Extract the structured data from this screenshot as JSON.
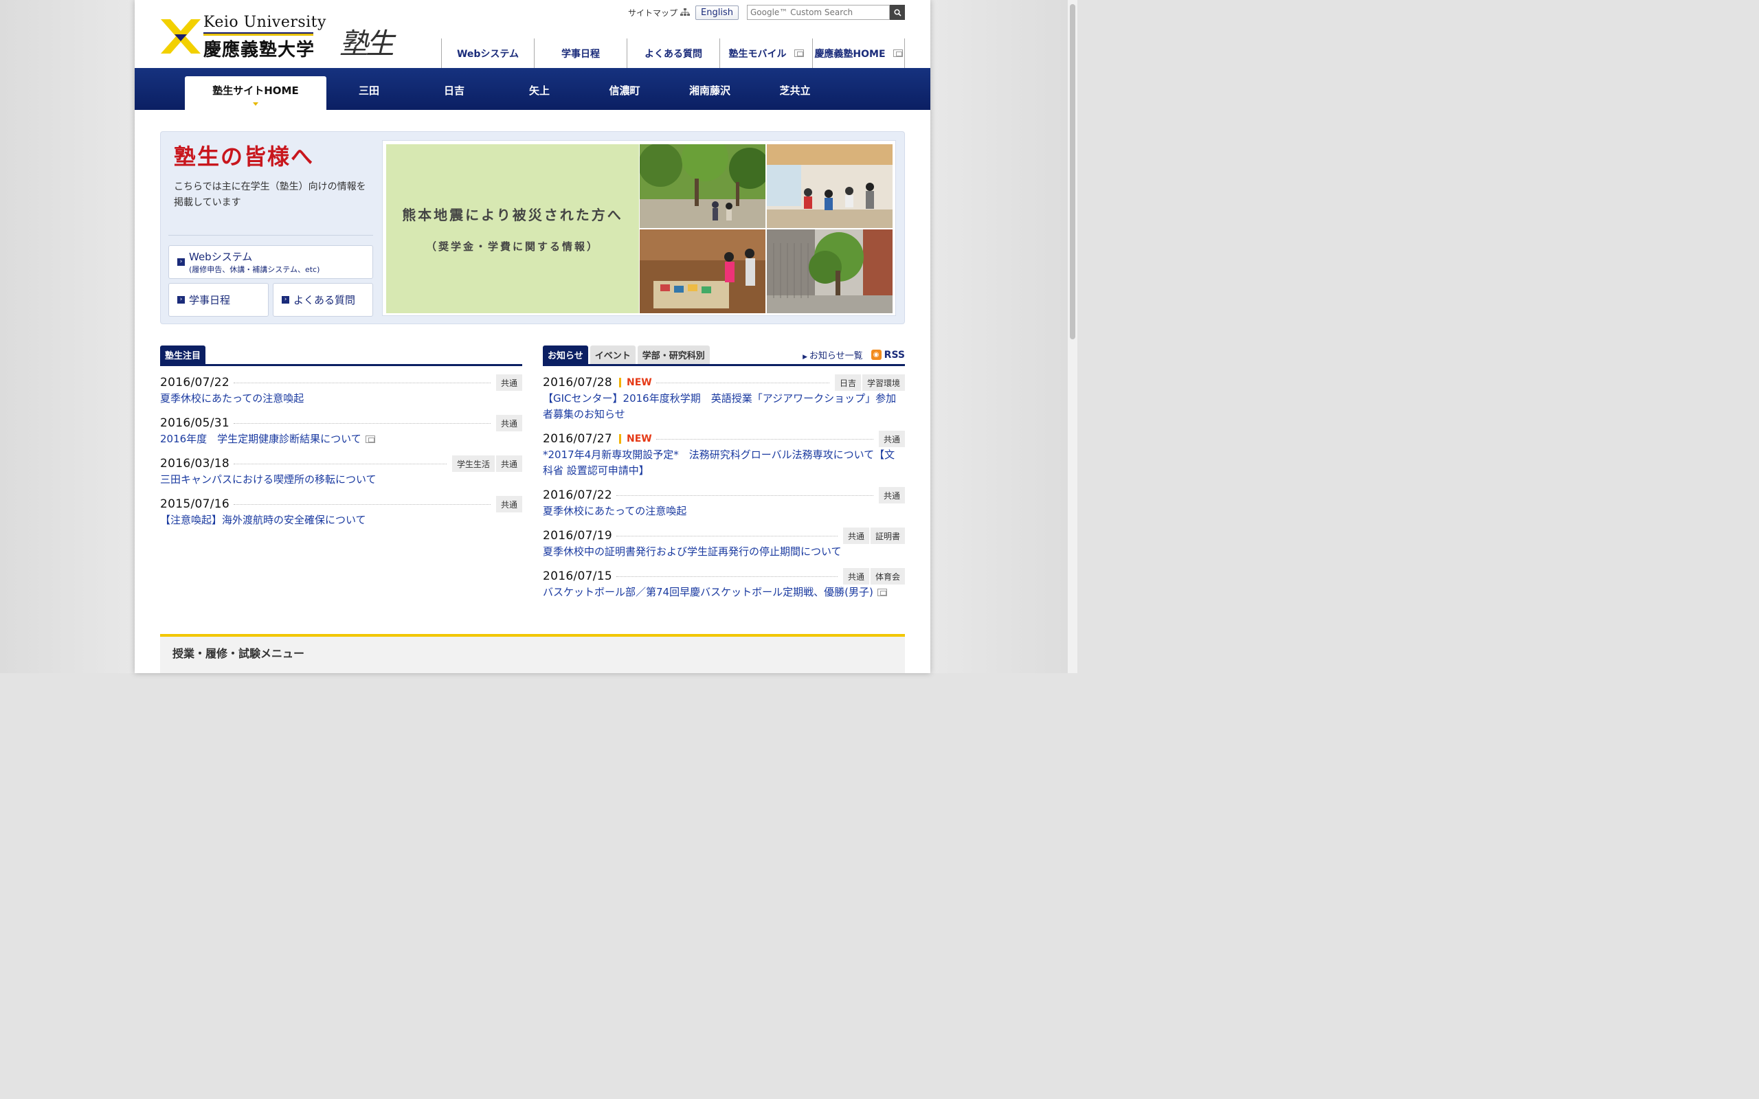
{
  "header": {
    "logo_en": "Keio University",
    "logo_ja": "慶應義塾大学",
    "site_logo": "塾生",
    "sitemap_label": "サイトマップ",
    "english_label": "English",
    "search_placeholder": "Google™ Custom Search",
    "topnav": [
      {
        "label": "Webシステム",
        "external": false
      },
      {
        "label": "学事日程",
        "external": false
      },
      {
        "label": "よくある質問",
        "external": false
      },
      {
        "label": "塾生モバイル",
        "external": true
      },
      {
        "label": "慶應義塾HOME",
        "external": true
      }
    ]
  },
  "campus_nav": {
    "tabs": [
      "塾生サイトHOME",
      "三田",
      "日吉",
      "矢上",
      "信濃町",
      "湘南藤沢",
      "芝共立"
    ],
    "active": 0
  },
  "hero": {
    "title": "塾生の皆様へ",
    "description": "こちらでは主に在学生（塾生）向けの情報を掲載しています",
    "webs_label": "Webシステム",
    "webs_sub": "(履修申告、休講・補講システム、etc)",
    "schedule_label": "学事日程",
    "faq_label": "よくある質問",
    "banner_main": "熊本地震により被災された方へ",
    "banner_sub": "（奨学金・学費に関する情報）"
  },
  "featured": {
    "tab_label": "塾生注目",
    "items": [
      {
        "date": "2016/07/22",
        "tags": [
          "共通"
        ],
        "title": "夏季休校にあたっての注意喚起",
        "external": false
      },
      {
        "date": "2016/05/31",
        "tags": [
          "共通"
        ],
        "title": "2016年度　学生定期健康診断結果について",
        "external": true
      },
      {
        "date": "2016/03/18",
        "tags": [
          "学生生活",
          "共通"
        ],
        "title": "三田キャンパスにおける喫煙所の移転について",
        "external": false
      },
      {
        "date": "2015/07/16",
        "tags": [
          "共通"
        ],
        "title": "【注意喚起】海外渡航時の安全確保について",
        "external": false
      }
    ]
  },
  "news": {
    "tabs": [
      "お知らせ",
      "イベント",
      "学部・研究科別"
    ],
    "list_link": "お知らせ一覧",
    "rss_label": "RSS",
    "items": [
      {
        "date": "2016/07/28",
        "new": "NEW",
        "tags": [
          "日吉",
          "学習環境"
        ],
        "title": "【GICセンター】2016年度秋学期　英語授業「アジアワークショップ」参加者募集のお知らせ",
        "external": false
      },
      {
        "date": "2016/07/27",
        "new": "NEW",
        "tags": [
          "共通"
        ],
        "title": "*2017年4月新専攻開設予定*　法務研究科グローバル法務専攻について【文科省 設置認可申請中】",
        "external": false
      },
      {
        "date": "2016/07/22",
        "new": "",
        "tags": [
          "共通"
        ],
        "title": "夏季休校にあたっての注意喚起",
        "external": false
      },
      {
        "date": "2016/07/19",
        "new": "",
        "tags": [
          "共通",
          "証明書"
        ],
        "title": "夏季休校中の証明書発行および学生証再発行の停止期間について",
        "external": false
      },
      {
        "date": "2016/07/15",
        "new": "",
        "tags": [
          "共通",
          "体育会"
        ],
        "title": "バスケットボール部／第74回早慶バスケットボール定期戦、優勝(男子)",
        "external": true
      }
    ]
  },
  "bottom_menu": {
    "title": "授業・履修・試験メニュー"
  },
  "colors": {
    "navy": "#0b1f63",
    "link": "#1a3aa0",
    "accent_yellow": "#f2c700",
    "title_red": "#c8161d",
    "new_red": "#e53a17"
  },
  "icons": [
    "keio-pen-mark-icon",
    "sitemap-icon",
    "search-icon",
    "external-window-icon",
    "arrow-right-icon",
    "rss-icon"
  ]
}
